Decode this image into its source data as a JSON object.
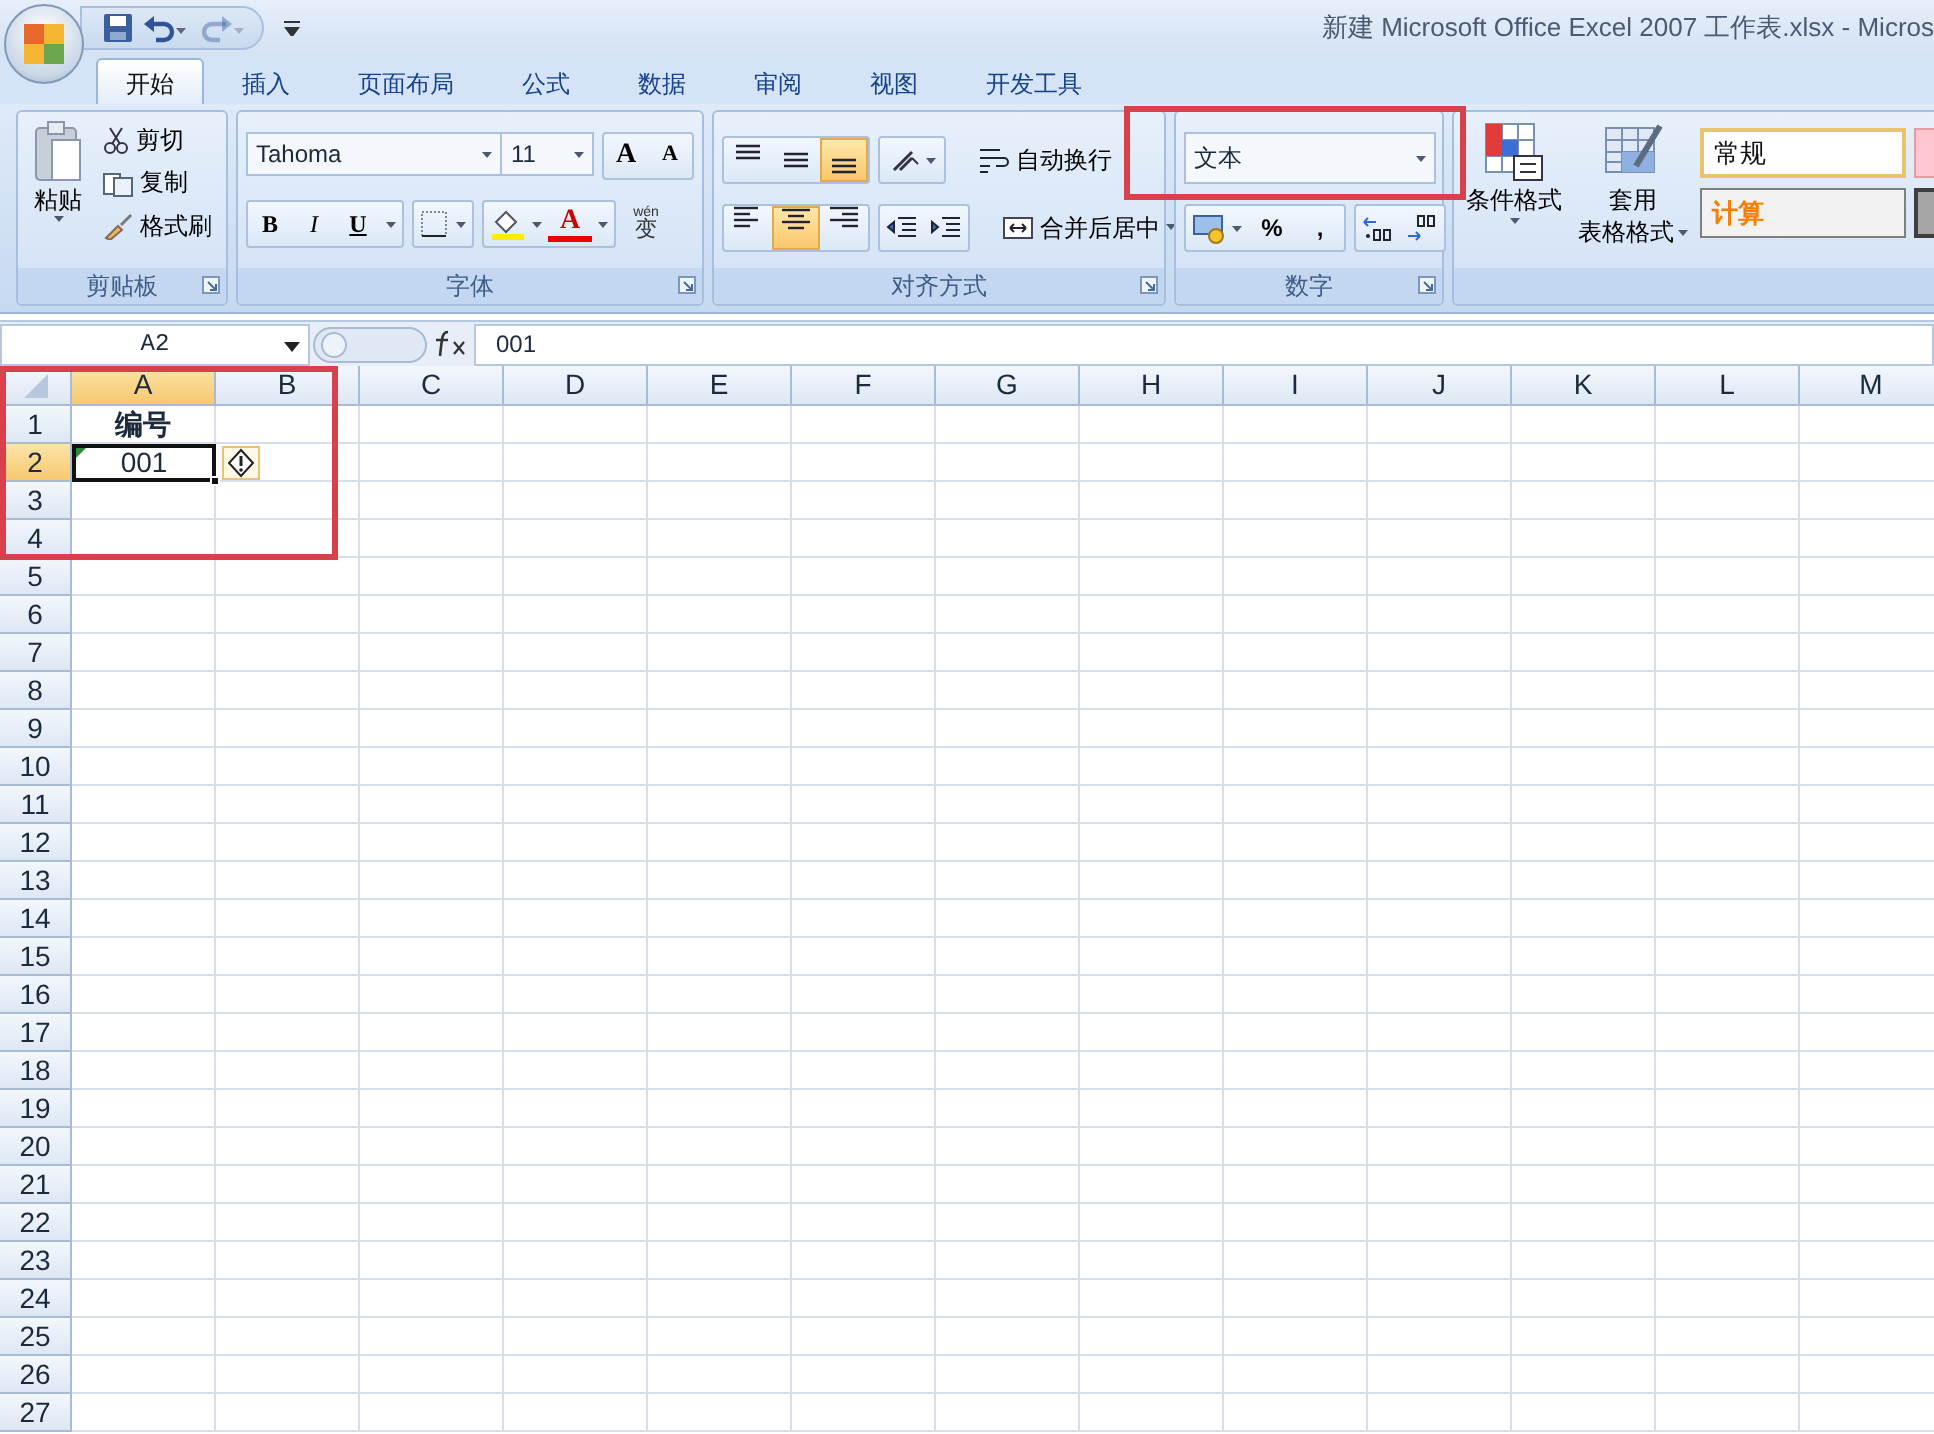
{
  "window": {
    "title": "新建 Microsoft Office Excel 2007 工作表.xlsx - Micros"
  },
  "quick_access": [
    {
      "kind": "save",
      "disabled": false
    },
    {
      "kind": "undo",
      "disabled": false
    },
    {
      "kind": "redo",
      "disabled": true
    }
  ],
  "tabs": [
    {
      "label": "开始",
      "selected": true
    },
    {
      "label": "插入",
      "selected": false
    },
    {
      "label": "页面布局",
      "selected": false
    },
    {
      "label": "公式",
      "selected": false
    },
    {
      "label": "数据",
      "selected": false
    },
    {
      "label": "审阅",
      "selected": false
    },
    {
      "label": "视图",
      "selected": false
    },
    {
      "label": "开发工具",
      "selected": false
    }
  ],
  "clipboard": {
    "label": "剪贴板",
    "paste": "粘贴",
    "commands": [
      "剪切",
      "复制",
      "格式刷"
    ]
  },
  "font": {
    "label": "字体",
    "name": "Tahoma",
    "size": "11",
    "size_buttons": [
      "A",
      "A"
    ],
    "styles": [
      "B",
      "I",
      "U"
    ],
    "color_letter": "A",
    "phonetic": {
      "ruby": "wén",
      "char": "变"
    }
  },
  "alignment": {
    "label": "对齐方式",
    "vertical": [
      {
        "selected": false
      },
      {
        "selected": false
      },
      {
        "selected": true
      }
    ],
    "horizontal": [
      {
        "selected": false
      },
      {
        "selected": true
      },
      {
        "selected": false
      }
    ],
    "wrap_text": "自动换行",
    "merge": "合并后居中"
  },
  "number": {
    "label": "数字",
    "format": "文本",
    "highlighted": true,
    "symbols": [
      "%",
      ","
    ]
  },
  "styles": {
    "conditional": "条件格式",
    "table_format": [
      "套用",
      "表格格式"
    ],
    "cell_styles": [
      {
        "label": "常规",
        "kind": "normal"
      },
      {
        "label": "计算",
        "kind": "calculation"
      }
    ]
  },
  "formula_bar": {
    "name_box": "A2",
    "value": "001"
  },
  "sheet": {
    "highlighted": true,
    "columns": [
      {
        "label": "A",
        "selected": true
      },
      {
        "label": "B",
        "selected": false
      },
      {
        "label": "C",
        "selected": false
      },
      {
        "label": "D",
        "selected": false
      },
      {
        "label": "E",
        "selected": false
      },
      {
        "label": "F",
        "selected": false
      },
      {
        "label": "G",
        "selected": false
      },
      {
        "label": "H",
        "selected": false
      },
      {
        "label": "I",
        "selected": false
      },
      {
        "label": "J",
        "selected": false
      },
      {
        "label": "K",
        "selected": false
      },
      {
        "label": "L",
        "selected": false
      },
      {
        "label": "M",
        "selected": false
      }
    ],
    "rows": [
      {
        "label": "1",
        "selected": false,
        "cells": [
          {
            "text": "编号",
            "bold": true,
            "active": false,
            "error_flag": false
          }
        ]
      },
      {
        "label": "2",
        "selected": true,
        "cells": [
          {
            "text": "001",
            "bold": false,
            "active": true,
            "error_flag": true
          }
        ]
      },
      {
        "label": "3",
        "selected": false
      },
      {
        "label": "4",
        "selected": false
      },
      {
        "label": "5",
        "selected": false
      },
      {
        "label": "6",
        "selected": false
      },
      {
        "label": "7",
        "selected": false
      },
      {
        "label": "8",
        "selected": false
      },
      {
        "label": "9",
        "selected": false
      },
      {
        "label": "10",
        "selected": false
      },
      {
        "label": "11",
        "selected": false
      },
      {
        "label": "12",
        "selected": false
      },
      {
        "label": "13",
        "selected": false
      },
      {
        "label": "14",
        "selected": false
      },
      {
        "label": "15",
        "selected": false
      },
      {
        "label": "16",
        "selected": false
      },
      {
        "label": "17",
        "selected": false
      },
      {
        "label": "18",
        "selected": false
      },
      {
        "label": "19",
        "selected": false
      },
      {
        "label": "20",
        "selected": false
      },
      {
        "label": "21",
        "selected": false
      },
      {
        "label": "22",
        "selected": false
      },
      {
        "label": "23",
        "selected": false
      },
      {
        "label": "24",
        "selected": false
      },
      {
        "label": "25",
        "selected": false
      },
      {
        "label": "26",
        "selected": false
      },
      {
        "label": "27",
        "selected": false
      }
    ]
  }
}
